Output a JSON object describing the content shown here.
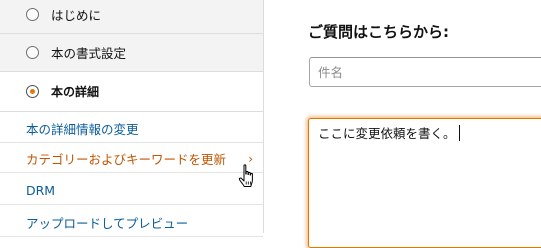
{
  "sidebar": {
    "steps": [
      {
        "label": "はじめに",
        "selected": false
      },
      {
        "label": "本の書式設定",
        "selected": false
      },
      {
        "label": "本の詳細",
        "selected": true
      }
    ],
    "links": [
      {
        "label": "本の詳細情報の変更"
      },
      {
        "label": "カテゴリーおよびキーワードを更新",
        "hovered": true,
        "chevron": "›"
      },
      {
        "label": "DRM"
      },
      {
        "label": "アップロードしてプレビュー"
      }
    ]
  },
  "main": {
    "title": "ご質問はこちらから:",
    "subject_placeholder": "件名",
    "message_value": "ここに変更依頼を書く。"
  },
  "colors": {
    "link": "#0a5c9c",
    "link_hover": "#c45500",
    "focus_border": "#e77600",
    "radio_selected": "#e47911"
  },
  "icons": {
    "cursor": "hand-pointer-cursor",
    "chevron": "chevron-right"
  }
}
